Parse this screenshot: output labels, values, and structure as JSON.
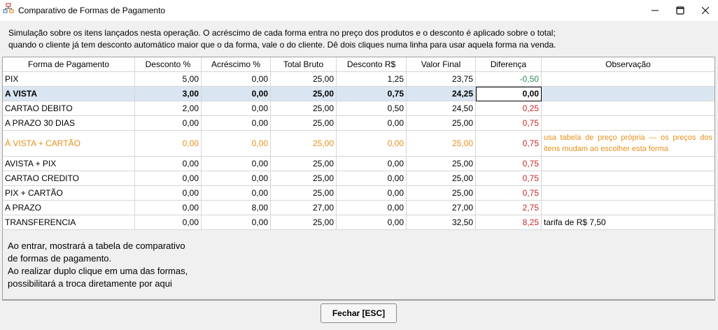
{
  "window": {
    "title": "Comparativo de Formas de Pagamento",
    "minimize_icon": "minimize-icon",
    "maximize_icon": "maximize-icon",
    "close_icon": "close-icon"
  },
  "description": {
    "line1": "Simulação sobre os itens lançados nesta operação. O acréscimo de cada forma entra no preço dos produtos e o desconto é aplicado sobre o total;",
    "line2": "quando o cliente já tem desconto automático maior que o da forma, vale o do cliente. Dê dois cliques numa linha para usar aquela forma na venda."
  },
  "table": {
    "headers": [
      "Forma de Pagamento",
      "Desconto %",
      "Acréscimo %",
      "Total Bruto",
      "Desconto R$",
      "Valor Final",
      "Diferença",
      "Observação"
    ],
    "rows": [
      {
        "forma": "PIX",
        "desc_pct": "5,00",
        "acr_pct": "0,00",
        "total": "25,00",
        "desc_rs": "1,25",
        "final": "23,75",
        "dif": "-0,50",
        "obs": ""
      },
      {
        "forma": "A VISTA",
        "desc_pct": "3,00",
        "acr_pct": "0,00",
        "total": "25,00",
        "desc_rs": "0,75",
        "final": "24,25",
        "dif": "0,00",
        "obs": ""
      },
      {
        "forma": "CARTAO DEBITO",
        "desc_pct": "2,00",
        "acr_pct": "0,00",
        "total": "25,00",
        "desc_rs": "0,50",
        "final": "24,50",
        "dif": "0,25",
        "obs": ""
      },
      {
        "forma": "A PRAZO 30 DIAS",
        "desc_pct": "0,00",
        "acr_pct": "0,00",
        "total": "25,00",
        "desc_rs": "0,00",
        "final": "25,00",
        "dif": "0,75",
        "obs": ""
      },
      {
        "forma": "À VISTA + CARTÃO",
        "desc_pct": "0,00",
        "acr_pct": "0,00",
        "total": "25,00",
        "desc_rs": "0,00",
        "final": "25,00",
        "dif": "0,75",
        "obs": "usa tabela de preço própria — os preços dos itens mudam ao escolher esta forma"
      },
      {
        "forma": "AVISTA + PIX",
        "desc_pct": "0,00",
        "acr_pct": "0,00",
        "total": "25,00",
        "desc_rs": "0,00",
        "final": "25,00",
        "dif": "0,75",
        "obs": ""
      },
      {
        "forma": "CARTAO CREDITO",
        "desc_pct": "0,00",
        "acr_pct": "0,00",
        "total": "25,00",
        "desc_rs": "0,00",
        "final": "25,00",
        "dif": "0,75",
        "obs": ""
      },
      {
        "forma": "PIX + CARTÃO",
        "desc_pct": "0,00",
        "acr_pct": "0,00",
        "total": "25,00",
        "desc_rs": "0,00",
        "final": "25,00",
        "dif": "0,75",
        "obs": ""
      },
      {
        "forma": "A PRAZO",
        "desc_pct": "0,00",
        "acr_pct": "8,00",
        "total": "27,00",
        "desc_rs": "0,00",
        "final": "27,00",
        "dif": "2,75",
        "obs": ""
      },
      {
        "forma": "TRANSFERENCIA",
        "desc_pct": "0,00",
        "acr_pct": "0,00",
        "total": "25,00",
        "desc_rs": "0,00",
        "final": "32,50",
        "dif": "8,25",
        "obs": "tarifa de R$ 7,50"
      }
    ]
  },
  "note": {
    "line1": "Ao entrar, mostrará a tabela de comparativo",
    "line2": "de formas de pagamento.",
    "line3": "Ao realizar duplo clique em uma das formas,",
    "line4": "possibilitará a troca diretamente por aqui"
  },
  "footer": {
    "close_label": "Fechar [ESC]"
  },
  "colors": {
    "selected_row": "#d9e6f2",
    "orange_text": "#e8901c",
    "negative_diff": "#2e8b57",
    "positive_diff": "#c62828"
  }
}
